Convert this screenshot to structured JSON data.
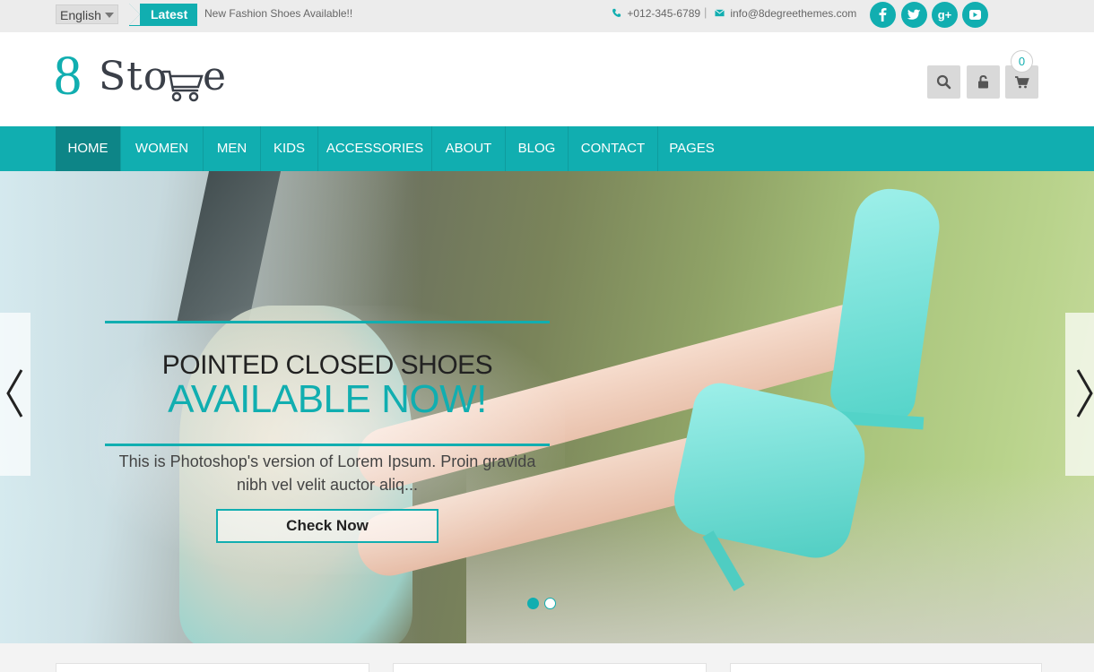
{
  "topbar": {
    "language": "English",
    "latest_label": "Latest",
    "ticker_text": "New Fashion Shoes Available!!",
    "phone": "+012-345-6789",
    "separator": "|",
    "email": "info@8degreethemes.com",
    "social": [
      {
        "name": "facebook-icon",
        "glyph": "f"
      },
      {
        "name": "twitter-icon",
        "glyph": "t"
      },
      {
        "name": "google-plus-icon",
        "glyph": "g+"
      },
      {
        "name": "youtube-icon",
        "glyph": "▶"
      }
    ]
  },
  "header": {
    "logo_numeral": "8",
    "logo_text_left": "Sto",
    "logo_text_right": "e",
    "cart_count": "0"
  },
  "nav": {
    "items": [
      {
        "label": "HOME",
        "active": true
      },
      {
        "label": "WOMEN"
      },
      {
        "label": "MEN"
      },
      {
        "label": "KIDS"
      },
      {
        "label": "ACCESSORIES"
      },
      {
        "label": "ABOUT"
      },
      {
        "label": "BLOG"
      },
      {
        "label": "CONTACT"
      },
      {
        "label": "PAGES"
      }
    ]
  },
  "hero": {
    "title_line1": "POINTED CLOSED SHOES",
    "title_line2": "AVAILABLE NOW!",
    "description": "This is Photoshop's version of Lorem Ipsum. Proin gravida nibh vel velit auctor aliq...",
    "button_label": "Check Now",
    "slides_total": 2,
    "active_slide": 1
  },
  "colors": {
    "accent": "#11aeb0",
    "nav_active": "#0d8587",
    "topbar_bg": "#ececec"
  }
}
